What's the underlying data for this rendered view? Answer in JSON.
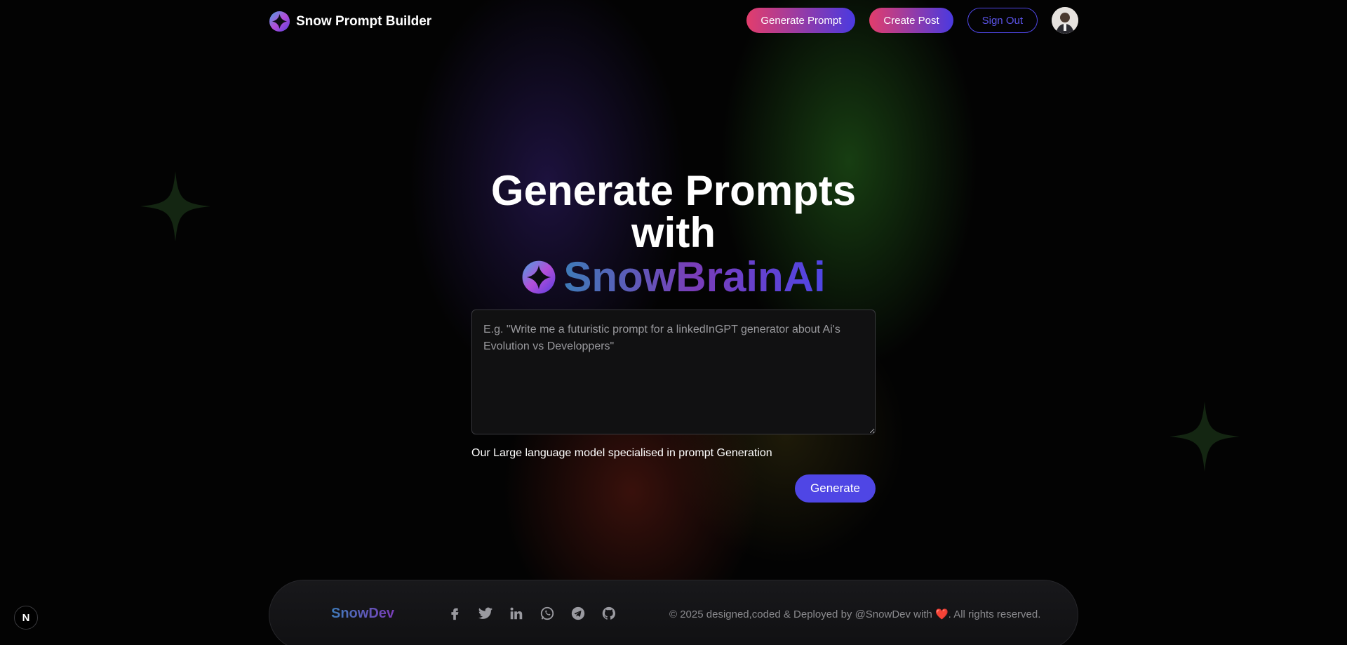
{
  "header": {
    "brand_name": "Snow Prompt Builder",
    "nav": {
      "generate_prompt": "Generate Prompt",
      "create_post": "Create Post",
      "sign_out": "Sign Out"
    }
  },
  "hero": {
    "title": "Generate Prompts with",
    "brand": "SnowBrainAi",
    "prompt_placeholder": "E.g. \"Write me a futuristic prompt for a linkedInGPT generator about Ai's Evolution vs Developpers\"",
    "hint": "Our Large language model specialised in prompt Generation",
    "generate_label": "Generate"
  },
  "footer": {
    "brand": "SnowDev",
    "socials": [
      "facebook-icon",
      "twitter-icon",
      "linkedin-icon",
      "whatsapp-icon",
      "telegram-icon",
      "github-icon"
    ],
    "copyright": "© 2025 designed,coded & Deployed by @SnowDev with ❤️. All rights reserved."
  },
  "badge": {
    "label": "N"
  },
  "colors": {
    "accent": "#4f46e5",
    "gradient_start": "#e23d6c",
    "background": "#030303"
  }
}
